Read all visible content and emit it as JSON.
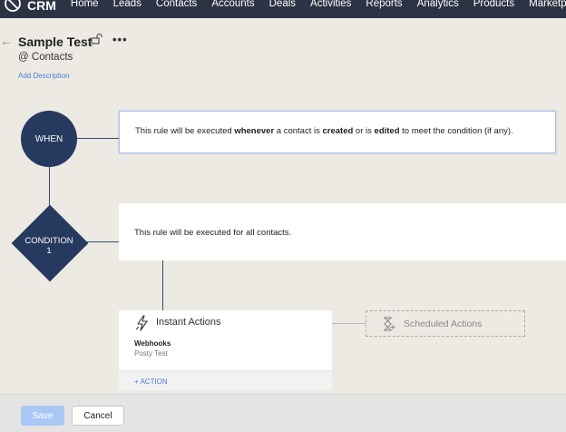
{
  "nav": {
    "brand": "CRM",
    "items": [
      "Home",
      "Leads",
      "Contacts",
      "Accounts",
      "Deals",
      "Activities",
      "Reports",
      "Analytics",
      "Products",
      "Marketplace"
    ],
    "more": "•••"
  },
  "header": {
    "rule_name": "Sample Test",
    "module_prefix": "@",
    "module": "Contacts",
    "add_description": "Add Description",
    "more": "•••"
  },
  "when": {
    "label": "WHEN",
    "text_1": "This rule will be executed ",
    "bold_1": "whenever",
    "text_2": " a contact is ",
    "bold_2": "created",
    "text_3": " or is ",
    "bold_3": "edited",
    "text_4": " to meet the condition (if any)."
  },
  "condition": {
    "label": "CONDITION",
    "number": "1",
    "text": "This rule will be executed for all contacts."
  },
  "instant_actions": {
    "title": "Instant Actions",
    "section": "Webhooks",
    "item": "Posty Test",
    "add_action": "+ ACTION"
  },
  "scheduled_actions": {
    "title": "Scheduled Actions"
  },
  "footer": {
    "save": "Save",
    "cancel": "Cancel"
  },
  "colors": {
    "nav_bg": "#2c3344",
    "node_bg": "#253a5e",
    "link": "#4a7fd6",
    "save_btn": "#a9c8f5"
  }
}
